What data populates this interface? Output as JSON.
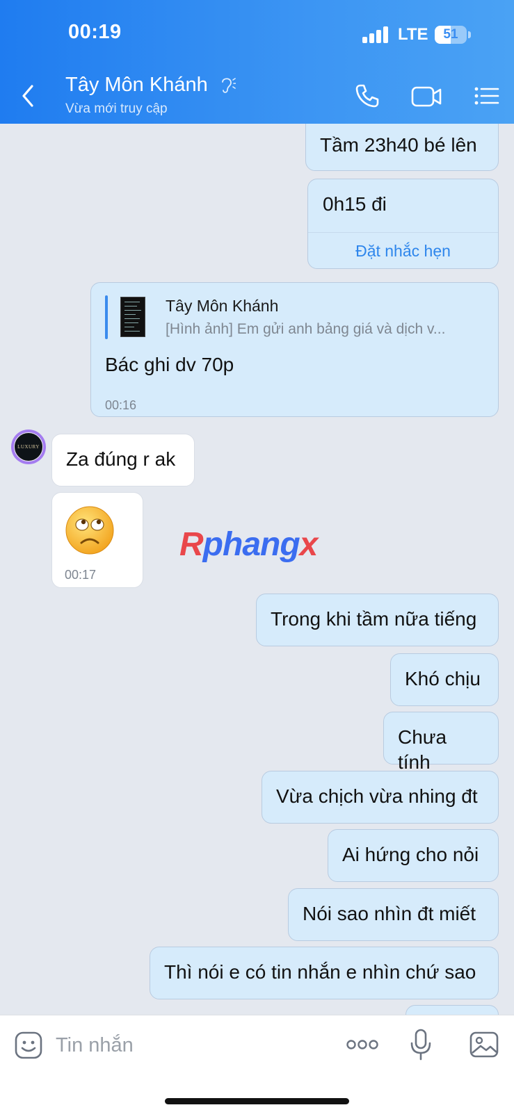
{
  "status_bar": {
    "time": "00:19",
    "network": "LTE",
    "battery": "51",
    "battery_level": 0.51
  },
  "header": {
    "contact_name": "Tây Môn Khánh",
    "contact_status": "Vừa mới truy cập"
  },
  "messages": [
    {
      "direction": "outgoing",
      "text": "Tầm 23h40 bé lên"
    },
    {
      "direction": "outgoing",
      "text": "0h15 đi",
      "action": "Đặt nhắc hẹn"
    },
    {
      "direction": "outgoing",
      "quote": {
        "name": "Tây Môn Khánh",
        "preview": "[Hình ảnh] Em gửi anh bảng giá và dịch v..."
      },
      "text": "Bác ghi dv 70p",
      "time": "00:16"
    },
    {
      "direction": "incoming",
      "text": "Za đúng r ak"
    },
    {
      "direction": "incoming",
      "sticker": "sad-face",
      "time": "00:17"
    },
    {
      "direction": "outgoing",
      "text": "Trong khi tầm nữa tiếng"
    },
    {
      "direction": "outgoing",
      "text": "Khó chịu"
    },
    {
      "direction": "outgoing",
      "text": "Chưa tính"
    },
    {
      "direction": "outgoing",
      "text": "Vừa chịch vừa nhing đt"
    },
    {
      "direction": "outgoing",
      "text": "Ai hứng cho nỏi"
    },
    {
      "direction": "outgoing",
      "text": "Nói sao nhìn đt miết"
    },
    {
      "direction": "outgoing",
      "text": "Thì nói e có tin nhắn e nhìn chứ sao"
    }
  ],
  "avatar": {
    "label": "LUXURY"
  },
  "watermark": {
    "part1": "R",
    "part2": "phang",
    "part3": "x"
  },
  "composer": {
    "placeholder": "Tin nhắn"
  },
  "colors": {
    "header_gradient_start": "#1f7cf0",
    "header_gradient_end": "#4aa2f4",
    "outgoing_bubble": "#d6ebfb",
    "incoming_bubble": "#ffffff",
    "chat_background": "#e4e8ef",
    "link": "#2e86ec"
  }
}
